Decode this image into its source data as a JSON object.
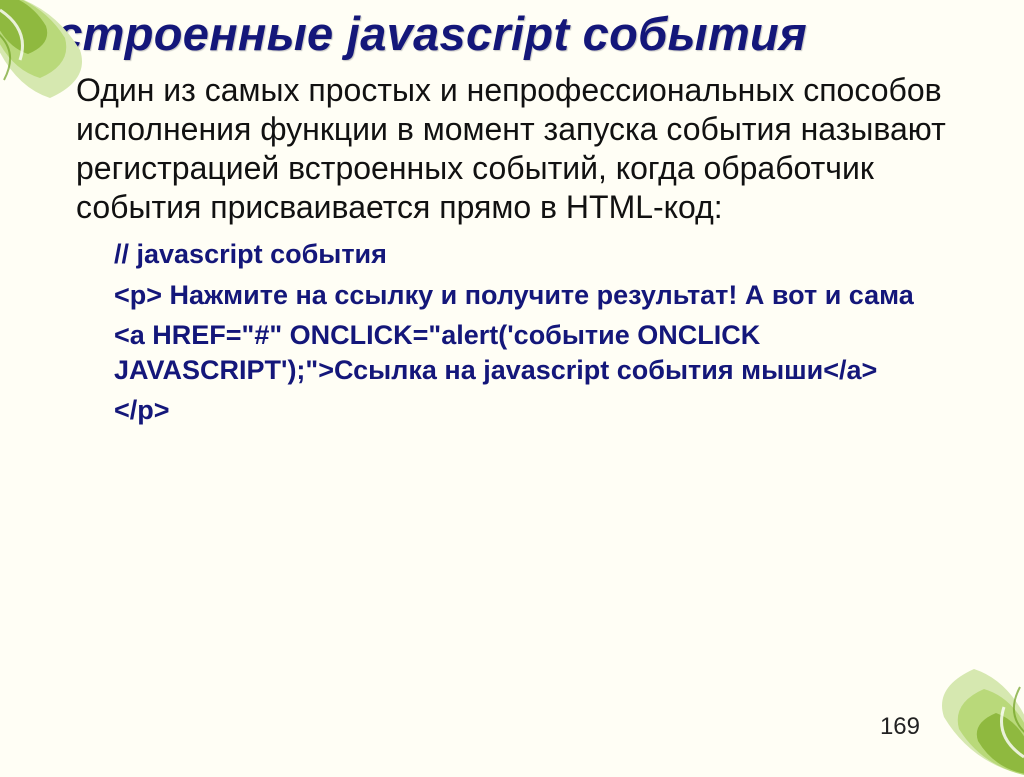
{
  "slide": {
    "title": "Встроенные javascript события",
    "paragraph": "Один из самых простых и непрофессиональных способов исполнения функции в момент запуска события называют регистрацией встроенных событий, когда обработчик события присваивается прямо в HTML-код:",
    "code": {
      "l1": "// javascript события",
      "l2": "<p> Нажмите на ссылку и получите результат! А вот и сама",
      "l3": "<a HREF=\"#\" ONCLICK=\"alert('событие ONCLICK JAVASCRIPT');\">Ссылка на javascript события мыши</a>",
      "l4": "</p>"
    },
    "page_number": "169"
  }
}
